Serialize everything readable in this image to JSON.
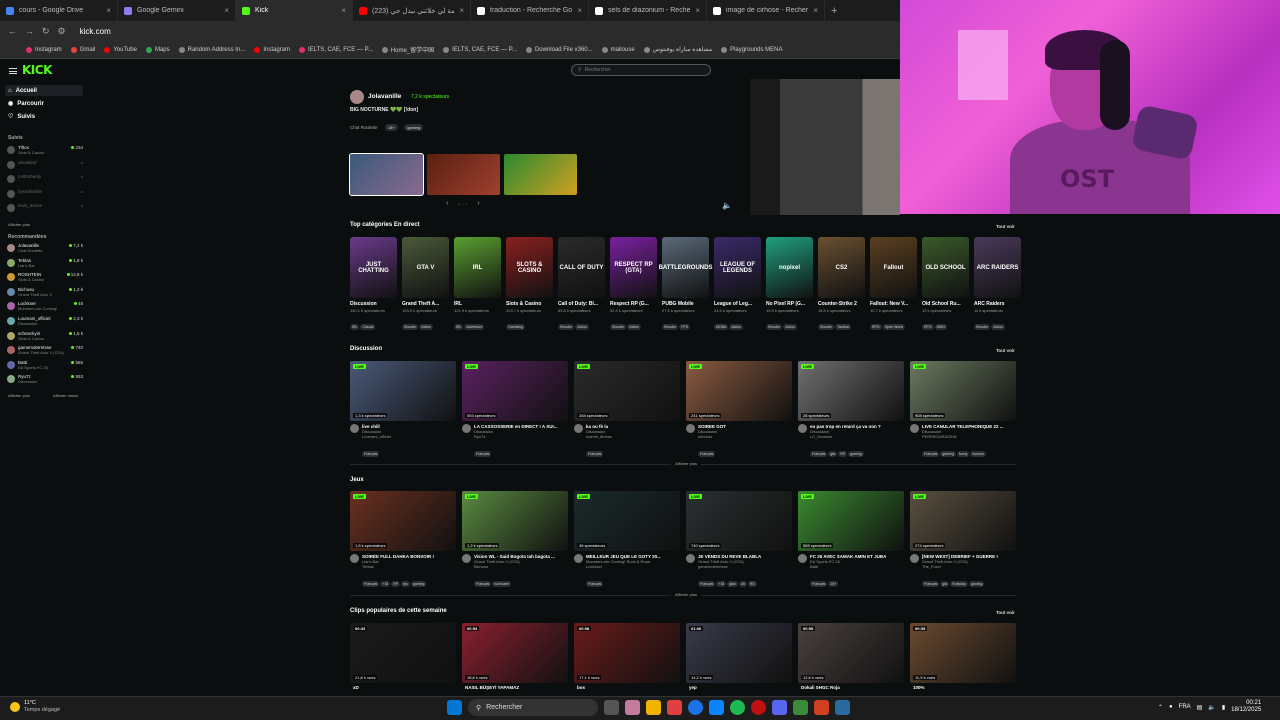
{
  "browser": {
    "tabs": [
      {
        "label": "cours - Google Drive",
        "color": "#4285f4",
        "active": false
      },
      {
        "label": "Google Gemini",
        "color": "#8e7cf0",
        "active": false
      },
      {
        "label": "Kick",
        "color": "#53fc18",
        "active": true
      },
      {
        "label": "(223) المرضة لي خلاتني نبدل حي",
        "color": "#ff0000",
        "active": false
      },
      {
        "label": "traduction - Recherche Google",
        "color": "#ffffff",
        "active": false
      },
      {
        "label": "sels de diazonium - Recherche",
        "color": "#ffffff",
        "active": false
      },
      {
        "label": "image de cirhose - Recherche",
        "color": "#ffffff",
        "active": false
      }
    ],
    "new_tab": "+",
    "url": "kick.com",
    "bookmarks": [
      "Instagram",
      "Gmail",
      "YouTube",
      "Maps",
      "Random Address In...",
      "Instagram",
      "IELTS, CAE, FCE — P...",
      "Home_留学中国",
      "IELTS, CAE, FCE — P...",
      "Download File x360...",
      "mailouse",
      "مشاهدة مباراة يوفنتوس",
      "Playgrounds MENA"
    ]
  },
  "kick": {
    "logo": "KICK",
    "nav": [
      {
        "label": "Accueil",
        "icon": "home-icon",
        "selected": true
      },
      {
        "label": "Parcourir",
        "icon": "compass-icon",
        "selected": false
      },
      {
        "label": "Suivis",
        "icon": "heart-icon",
        "selected": false
      }
    ],
    "followed_title": "Suivis",
    "followed": [
      {
        "name": "Tiftox",
        "sub": "Slots & Casino",
        "viewers": "234",
        "online": true
      },
      {
        "name": "ultraMind",
        "sub": "",
        "viewers": "",
        "online": false
      },
      {
        "name": "mrBarbarity",
        "sub": "",
        "viewers": "",
        "online": false
      },
      {
        "name": "bysenheible",
        "sub": "",
        "viewers": "",
        "online": false
      },
      {
        "name": "louis_amour",
        "sub": "",
        "viewers": "",
        "online": false
      }
    ],
    "followed_more": "Afficher plus",
    "recommended_title": "Recommandées",
    "recommended": [
      {
        "name": "Jolavanille",
        "sub": "Chat Roulette",
        "viewers": "7,2 k"
      },
      {
        "name": "Teblas",
        "sub": "Liar's Bar",
        "viewers": "1,8 k"
      },
      {
        "name": "ROSHTEIN",
        "sub": "Slots & Casino",
        "viewers": "12,8 k"
      },
      {
        "name": "Bichosu",
        "sub": "Grand Theft Auto V",
        "viewers": "1,2 k"
      },
      {
        "name": "Lockkser",
        "sub": "Monsters are Coming!",
        "viewers": "48"
      },
      {
        "name": "Loumani_officiel",
        "sub": "Discussion",
        "viewers": "2,3 k"
      },
      {
        "name": "schneckyiri",
        "sub": "Slots & Casino",
        "viewers": "1,5 k"
      },
      {
        "name": "gamemdetretsse",
        "sub": "Grand Theft Auto V (GTA)",
        "viewers": "740"
      },
      {
        "name": "Batti",
        "sub": "EA Sports FC 26",
        "viewers": "565"
      },
      {
        "name": "Ryu7z",
        "sub": "Discussion",
        "viewers": "553"
      }
    ],
    "recommended_more": "Afficher plus",
    "recommended_less": "Afficher moins",
    "search_placeholder": "Rechercher",
    "featured": {
      "name": "Jolavanille",
      "viewers": "7,2 k spectateurs",
      "title": "BIG NOCTURNE 💚💚 [!don]",
      "category": "Chat Roulette",
      "tags": [
        "18+",
        "gaming"
      ]
    },
    "top_categories_title": "Top catégories En direct",
    "see_all": "Tout voir",
    "categories": [
      {
        "name": "Discussion",
        "count": "140,1 k spectateurs",
        "art": "JUST CHATTING",
        "color": "#6a3a8a",
        "tags": [
          "IRL",
          "Casual"
        ]
      },
      {
        "name": "Grand Theft A...",
        "count": "103,0 k spectateurs",
        "art": "GTA V",
        "color": "#4a5a3a",
        "tags": [
          "Shooter",
          "Action"
        ]
      },
      {
        "name": "IRL",
        "count": "121,9 k spectateurs",
        "art": "IRL",
        "color": "#5aa030",
        "tags": [
          "IRL",
          "Adventure"
        ]
      },
      {
        "name": "Slots & Casino",
        "count": "103,7 k spectateurs",
        "art": "SLOTS & CASINO",
        "color": "#8a2020",
        "tags": [
          "Gambling"
        ]
      },
      {
        "name": "Call of Duty: Bl...",
        "count": "60,8 k spectateurs",
        "art": "CALL OF DUTY",
        "color": "#2a2a2a",
        "tags": [
          "Shooter",
          "Action"
        ]
      },
      {
        "name": "Respect RP (G...",
        "count": "52,4 k spectateurs",
        "art": "RESPECT RP (GTA)",
        "color": "#7a20a0",
        "tags": [
          "Shooter",
          "Action"
        ]
      },
      {
        "name": "PUBG Mobile",
        "count": "27,6 k spectateurs",
        "art": "BATTLEGROUNDS",
        "color": "#5a6a7a",
        "tags": [
          "Shooter",
          "FPS"
        ]
      },
      {
        "name": "League of Leg...",
        "count": "24,5 k spectateurs",
        "art": "LEAGUE OF LEGENDS",
        "color": "#3a2a6a",
        "tags": [
          "MOBA",
          "Action"
        ]
      },
      {
        "name": "No Pixel RP (G...",
        "count": "15,5 k spectateurs",
        "art": "nopixel",
        "color": "#20a080",
        "tags": [
          "Shooter",
          "Action"
        ]
      },
      {
        "name": "Counter-Strike 2",
        "count": "18,5 k spectateurs",
        "art": "CS2",
        "color": "#6a5030",
        "tags": [
          "Shooter",
          "Tactical"
        ]
      },
      {
        "name": "Fallout: New V...",
        "count": "10,7 k spectateurs",
        "art": "Fallout",
        "color": "#5a4020",
        "tags": [
          "RPG",
          "Open World"
        ]
      },
      {
        "name": "Old School Ru...",
        "count": "12 k spectateurs",
        "art": "OLD SCHOOL",
        "color": "#3a5a2a",
        "tags": [
          "RPG",
          "MMO"
        ]
      },
      {
        "name": "ARC Raiders",
        "count": "11 k spectateurs",
        "art": "ARC RAIDERS",
        "color": "#4a3a5a",
        "tags": [
          "Shooter",
          "Action"
        ]
      }
    ],
    "discussion_title": "Discussion",
    "discussion": [
      {
        "viewers": "1,3 k spectateurs",
        "title": "live chill",
        "cat": "Discussion",
        "user": "Loumani_officiel",
        "tags": [
          "Français"
        ],
        "color": "#4a5a7a"
      },
      {
        "viewers": "553 spectateurs",
        "title": "LA CASSOSSERIE en DIRECT ! A SUI...",
        "cat": "Discussion",
        "user": "Ryu7z",
        "tags": [
          "Français"
        ],
        "color": "#5a2060"
      },
      {
        "viewers": "284 spectateurs",
        "title": "ka ou fè la",
        "cat": "Discussion",
        "user": "marvel_fitness",
        "tags": [
          "Français"
        ],
        "color": "#2a2a2a"
      },
      {
        "viewers": "241 spectateurs",
        "title": "SOIREE GOT",
        "cat": "Discussion",
        "user": "minnoto",
        "tags": [
          "Français"
        ],
        "color": "#8a5a40"
      },
      {
        "viewers": "28 spectateurs",
        "title": "eu pas trop en retard ça va non ?",
        "cat": "Discussion",
        "user": "LC_Hoorses",
        "tags": [
          "Français",
          "gta",
          "RP",
          "gaming"
        ],
        "color": "#707070"
      },
      {
        "viewers": "908 spectateurs",
        "title": "LIVE CANULAR TELEPHONIQUE 22 ...",
        "cat": "Discussion",
        "user": "PEREBOURASSIN",
        "tags": [
          "Français",
          "gaming",
          "funny",
          "humour"
        ],
        "color": "#6a7a60"
      }
    ],
    "show_more": "Afficher plus",
    "games_title": "Jeux",
    "games": [
      {
        "viewers": "1,8 k spectateurs",
        "title": "SOIRÉE FULL DAHKA BONSOIR !",
        "cat": "Liar's Bar",
        "user": "Teblas",
        "tags": [
          "Français",
          "+18",
          "RP",
          "fps",
          "gaming"
        ],
        "color": "#6a3020"
      },
      {
        "viewers": "1,2 k spectateurs",
        "title": "Vision WL - Said Bogota tah bagota ...",
        "cat": "Grand Theft Auto V (GTA)",
        "user": "Bichosu",
        "tags": [
          "Français",
          "hurricane"
        ],
        "color": "#5a8a40"
      },
      {
        "viewers": "48 spectateurs",
        "title": "MEILLEUR JEU QUE LE GOTY 20...",
        "cat": "Monsters are Coming! Rock & Road",
        "user": "Lockkser",
        "tags": [
          "Français"
        ],
        "color": "#1a2a2a"
      },
      {
        "viewers": "740 spectateurs",
        "title": "JE VENDS DU REVE BLABLA",
        "cat": "Grand Theft Auto V (GTA)",
        "user": "gamemdetretsse",
        "tags": [
          "Français",
          "+18",
          "gtav",
          "alt",
          "RD"
        ],
        "color": "#2a3030"
      },
      {
        "viewers": "565 spectateurs",
        "title": "FC 26 AVEC SAMAK AMIN ET JUBA",
        "cat": "EA Sports FC 26",
        "user": "Batti",
        "tags": [
          "Français",
          "18+"
        ],
        "color": "#3a8a30"
      },
      {
        "viewers": "274 spectateurs",
        "title": "[NEW WEST] DEBRIEF + GUERRE !",
        "cat": "Grand Theft Auto V (GTA)",
        "user": "The_Fuzzi",
        "tags": [
          "Français",
          "gta",
          "Roleplay",
          "gaming"
        ],
        "color": "#5a5040"
      }
    ],
    "clips_title": "Clips populaires de cette semaine",
    "clips": [
      {
        "duration": "00:33",
        "views": "21,8 k vues",
        "title": "xD",
        "color": "#1a1a1a"
      },
      {
        "duration": "00:53",
        "views": "18,8 k vues",
        "title": "NASIL BÜŞEYİ YAPAMAZ",
        "color": "#8a2030"
      },
      {
        "duration": "00:58",
        "views": "17,1 k vues",
        "title": "bos",
        "color": "#6a1a1a"
      },
      {
        "duration": "01:00",
        "views": "14,2 k vues",
        "title": "yep",
        "color": "#3a3a4a"
      },
      {
        "duration": "00:55",
        "views": "12,6 k vues",
        "title": "Dokali SHGC Roja",
        "color": "#4a4040"
      },
      {
        "duration": "00:35",
        "views": "11,9 k vues",
        "title": "100%",
        "color": "#6a4a30"
      }
    ]
  },
  "taskbar": {
    "temp": "11°C",
    "weather": "Temps dégagé",
    "search": "Rechercher",
    "lang": "FRA",
    "time": "00:21",
    "date": "18/12/2025"
  }
}
